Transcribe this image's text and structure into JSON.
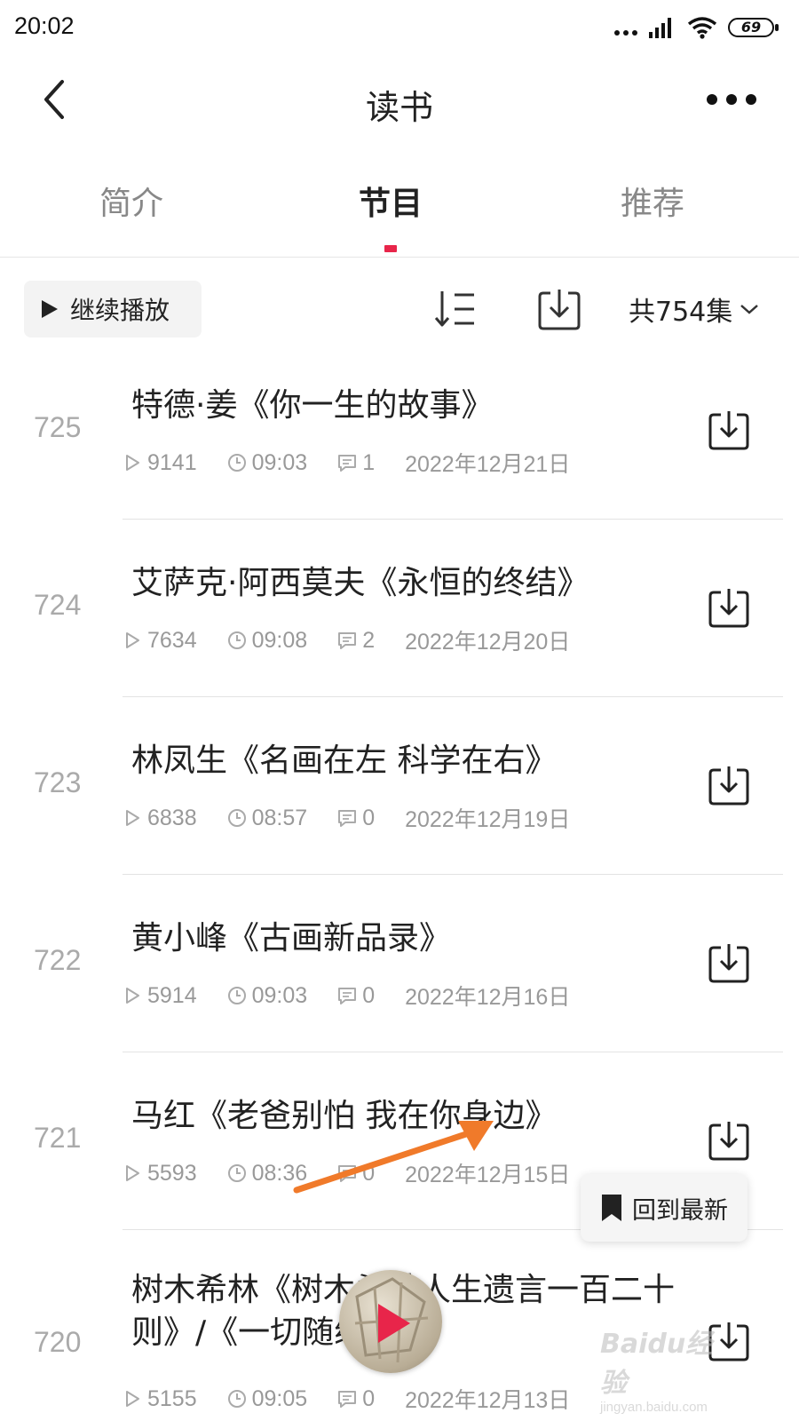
{
  "status_bar": {
    "time": "20:02",
    "battery": "69"
  },
  "nav": {
    "title": "读书"
  },
  "tabs": [
    {
      "label": "简介"
    },
    {
      "label": "节目"
    },
    {
      "label": "推荐"
    }
  ],
  "toolbar": {
    "continue_label": "继续播放",
    "episode_count": "共754集"
  },
  "episodes": [
    {
      "number": "725",
      "title": "特德·姜《你一生的故事》",
      "plays": "9141",
      "duration": "09:03",
      "comments": "1",
      "date": "2022年12月21日"
    },
    {
      "number": "724",
      "title": "艾萨克·阿西莫夫《永恒的终结》",
      "plays": "7634",
      "duration": "09:08",
      "comments": "2",
      "date": "2022年12月20日"
    },
    {
      "number": "723",
      "title": "林凤生《名画在左 科学在右》",
      "plays": "6838",
      "duration": "08:57",
      "comments": "0",
      "date": "2022年12月19日"
    },
    {
      "number": "722",
      "title": "黄小峰《古画新品录》",
      "plays": "5914",
      "duration": "09:03",
      "comments": "0",
      "date": "2022年12月16日"
    },
    {
      "number": "721",
      "title": "马红《老爸别怕 我在你身边》",
      "plays": "5593",
      "duration": "08:36",
      "comments": "0",
      "date": "2022年12月15日"
    },
    {
      "number": "720",
      "title": "树木希林《树木希林人生遗言一百二十则》/《一切随缘》",
      "plays": "5155",
      "duration": "09:05",
      "comments": "0",
      "date": "2022年12月13日"
    }
  ],
  "floating": {
    "back_to_latest": "回到最新"
  },
  "watermark": {
    "logo": "Baidu经验",
    "url": "jingyan.baidu.com"
  },
  "colors": {
    "accent": "#e8254a",
    "annotation_arrow": "#f07a2a"
  }
}
